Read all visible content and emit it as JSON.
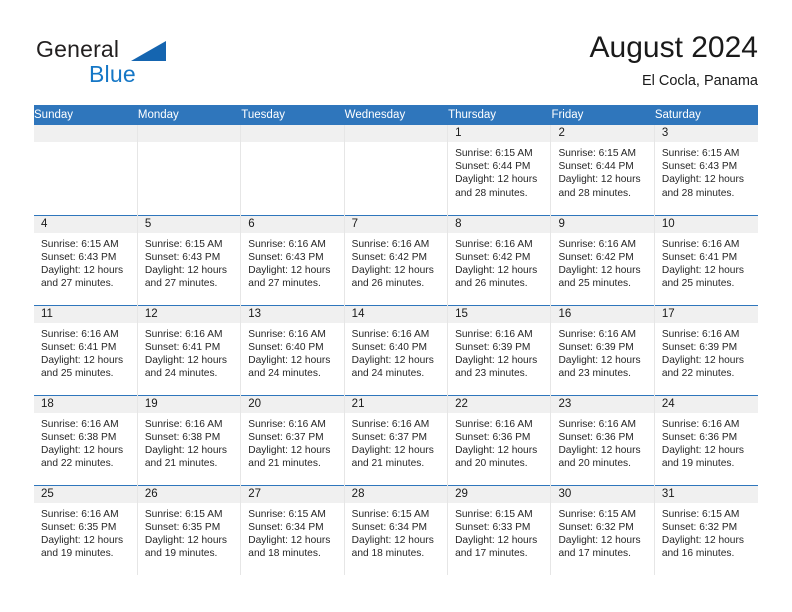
{
  "brand": {
    "name_part1": "General",
    "name_part2": "Blue"
  },
  "header": {
    "title": "August 2024",
    "subtitle": "El Cocla, Panama"
  },
  "colors": {
    "header_blue": "#2f76bc",
    "brand_blue": "#1577c6",
    "daynum_band": "#f0f0f0",
    "text": "#1a1a1a"
  },
  "weekdays": [
    "Sunday",
    "Monday",
    "Tuesday",
    "Wednesday",
    "Thursday",
    "Friday",
    "Saturday"
  ],
  "labels": {
    "sunrise_prefix": "Sunrise:",
    "sunset_prefix": "Sunset:",
    "daylight_prefix": "Daylight:"
  },
  "weeks": [
    [
      {
        "day": "",
        "sunrise": "",
        "sunset": "",
        "daylight_line1": "",
        "daylight_line2": ""
      },
      {
        "day": "",
        "sunrise": "",
        "sunset": "",
        "daylight_line1": "",
        "daylight_line2": ""
      },
      {
        "day": "",
        "sunrise": "",
        "sunset": "",
        "daylight_line1": "",
        "daylight_line2": ""
      },
      {
        "day": "",
        "sunrise": "",
        "sunset": "",
        "daylight_line1": "",
        "daylight_line2": ""
      },
      {
        "day": "1",
        "sunrise": "Sunrise: 6:15 AM",
        "sunset": "Sunset: 6:44 PM",
        "daylight_line1": "Daylight: 12 hours",
        "daylight_line2": "and 28 minutes."
      },
      {
        "day": "2",
        "sunrise": "Sunrise: 6:15 AM",
        "sunset": "Sunset: 6:44 PM",
        "daylight_line1": "Daylight: 12 hours",
        "daylight_line2": "and 28 minutes."
      },
      {
        "day": "3",
        "sunrise": "Sunrise: 6:15 AM",
        "sunset": "Sunset: 6:43 PM",
        "daylight_line1": "Daylight: 12 hours",
        "daylight_line2": "and 28 minutes."
      }
    ],
    [
      {
        "day": "4",
        "sunrise": "Sunrise: 6:15 AM",
        "sunset": "Sunset: 6:43 PM",
        "daylight_line1": "Daylight: 12 hours",
        "daylight_line2": "and 27 minutes."
      },
      {
        "day": "5",
        "sunrise": "Sunrise: 6:15 AM",
        "sunset": "Sunset: 6:43 PM",
        "daylight_line1": "Daylight: 12 hours",
        "daylight_line2": "and 27 minutes."
      },
      {
        "day": "6",
        "sunrise": "Sunrise: 6:16 AM",
        "sunset": "Sunset: 6:43 PM",
        "daylight_line1": "Daylight: 12 hours",
        "daylight_line2": "and 27 minutes."
      },
      {
        "day": "7",
        "sunrise": "Sunrise: 6:16 AM",
        "sunset": "Sunset: 6:42 PM",
        "daylight_line1": "Daylight: 12 hours",
        "daylight_line2": "and 26 minutes."
      },
      {
        "day": "8",
        "sunrise": "Sunrise: 6:16 AM",
        "sunset": "Sunset: 6:42 PM",
        "daylight_line1": "Daylight: 12 hours",
        "daylight_line2": "and 26 minutes."
      },
      {
        "day": "9",
        "sunrise": "Sunrise: 6:16 AM",
        "sunset": "Sunset: 6:42 PM",
        "daylight_line1": "Daylight: 12 hours",
        "daylight_line2": "and 25 minutes."
      },
      {
        "day": "10",
        "sunrise": "Sunrise: 6:16 AM",
        "sunset": "Sunset: 6:41 PM",
        "daylight_line1": "Daylight: 12 hours",
        "daylight_line2": "and 25 minutes."
      }
    ],
    [
      {
        "day": "11",
        "sunrise": "Sunrise: 6:16 AM",
        "sunset": "Sunset: 6:41 PM",
        "daylight_line1": "Daylight: 12 hours",
        "daylight_line2": "and 25 minutes."
      },
      {
        "day": "12",
        "sunrise": "Sunrise: 6:16 AM",
        "sunset": "Sunset: 6:41 PM",
        "daylight_line1": "Daylight: 12 hours",
        "daylight_line2": "and 24 minutes."
      },
      {
        "day": "13",
        "sunrise": "Sunrise: 6:16 AM",
        "sunset": "Sunset: 6:40 PM",
        "daylight_line1": "Daylight: 12 hours",
        "daylight_line2": "and 24 minutes."
      },
      {
        "day": "14",
        "sunrise": "Sunrise: 6:16 AM",
        "sunset": "Sunset: 6:40 PM",
        "daylight_line1": "Daylight: 12 hours",
        "daylight_line2": "and 24 minutes."
      },
      {
        "day": "15",
        "sunrise": "Sunrise: 6:16 AM",
        "sunset": "Sunset: 6:39 PM",
        "daylight_line1": "Daylight: 12 hours",
        "daylight_line2": "and 23 minutes."
      },
      {
        "day": "16",
        "sunrise": "Sunrise: 6:16 AM",
        "sunset": "Sunset: 6:39 PM",
        "daylight_line1": "Daylight: 12 hours",
        "daylight_line2": "and 23 minutes."
      },
      {
        "day": "17",
        "sunrise": "Sunrise: 6:16 AM",
        "sunset": "Sunset: 6:39 PM",
        "daylight_line1": "Daylight: 12 hours",
        "daylight_line2": "and 22 minutes."
      }
    ],
    [
      {
        "day": "18",
        "sunrise": "Sunrise: 6:16 AM",
        "sunset": "Sunset: 6:38 PM",
        "daylight_line1": "Daylight: 12 hours",
        "daylight_line2": "and 22 minutes."
      },
      {
        "day": "19",
        "sunrise": "Sunrise: 6:16 AM",
        "sunset": "Sunset: 6:38 PM",
        "daylight_line1": "Daylight: 12 hours",
        "daylight_line2": "and 21 minutes."
      },
      {
        "day": "20",
        "sunrise": "Sunrise: 6:16 AM",
        "sunset": "Sunset: 6:37 PM",
        "daylight_line1": "Daylight: 12 hours",
        "daylight_line2": "and 21 minutes."
      },
      {
        "day": "21",
        "sunrise": "Sunrise: 6:16 AM",
        "sunset": "Sunset: 6:37 PM",
        "daylight_line1": "Daylight: 12 hours",
        "daylight_line2": "and 21 minutes."
      },
      {
        "day": "22",
        "sunrise": "Sunrise: 6:16 AM",
        "sunset": "Sunset: 6:36 PM",
        "daylight_line1": "Daylight: 12 hours",
        "daylight_line2": "and 20 minutes."
      },
      {
        "day": "23",
        "sunrise": "Sunrise: 6:16 AM",
        "sunset": "Sunset: 6:36 PM",
        "daylight_line1": "Daylight: 12 hours",
        "daylight_line2": "and 20 minutes."
      },
      {
        "day": "24",
        "sunrise": "Sunrise: 6:16 AM",
        "sunset": "Sunset: 6:36 PM",
        "daylight_line1": "Daylight: 12 hours",
        "daylight_line2": "and 19 minutes."
      }
    ],
    [
      {
        "day": "25",
        "sunrise": "Sunrise: 6:16 AM",
        "sunset": "Sunset: 6:35 PM",
        "daylight_line1": "Daylight: 12 hours",
        "daylight_line2": "and 19 minutes."
      },
      {
        "day": "26",
        "sunrise": "Sunrise: 6:15 AM",
        "sunset": "Sunset: 6:35 PM",
        "daylight_line1": "Daylight: 12 hours",
        "daylight_line2": "and 19 minutes."
      },
      {
        "day": "27",
        "sunrise": "Sunrise: 6:15 AM",
        "sunset": "Sunset: 6:34 PM",
        "daylight_line1": "Daylight: 12 hours",
        "daylight_line2": "and 18 minutes."
      },
      {
        "day": "28",
        "sunrise": "Sunrise: 6:15 AM",
        "sunset": "Sunset: 6:34 PM",
        "daylight_line1": "Daylight: 12 hours",
        "daylight_line2": "and 18 minutes."
      },
      {
        "day": "29",
        "sunrise": "Sunrise: 6:15 AM",
        "sunset": "Sunset: 6:33 PM",
        "daylight_line1": "Daylight: 12 hours",
        "daylight_line2": "and 17 minutes."
      },
      {
        "day": "30",
        "sunrise": "Sunrise: 6:15 AM",
        "sunset": "Sunset: 6:32 PM",
        "daylight_line1": "Daylight: 12 hours",
        "daylight_line2": "and 17 minutes."
      },
      {
        "day": "31",
        "sunrise": "Sunrise: 6:15 AM",
        "sunset": "Sunset: 6:32 PM",
        "daylight_line1": "Daylight: 12 hours",
        "daylight_line2": "and 16 minutes."
      }
    ]
  ]
}
